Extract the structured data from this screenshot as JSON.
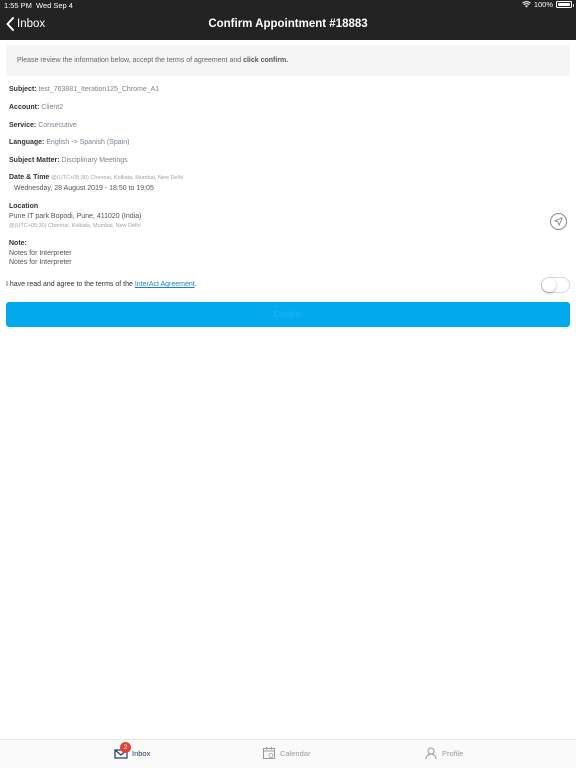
{
  "status_bar": {
    "time": "1:55 PM",
    "date": "Wed Sep 4",
    "battery": "100%"
  },
  "nav": {
    "back_label": "Inbox",
    "title": "Confirm Appointment #18883"
  },
  "info": {
    "text": "Please review the information below, accept the terms of agreement and ",
    "emphasis": "click confirm."
  },
  "fields": {
    "subject": {
      "label": "Subject:",
      "value": "test_763881_Iteration125_Chrome_A1"
    },
    "account": {
      "label": "Account:",
      "value": "Client2"
    },
    "service": {
      "label": "Service:",
      "value": "Consecutive"
    },
    "language": {
      "label": "Language:",
      "value": "English -> Spanish (Spain)"
    },
    "subject_matter": {
      "label": "Subject Matter:",
      "value": "Disciplinary Meetings"
    },
    "datetime": {
      "label": "Date & Time",
      "timezone": "@(UTC+05:30) Chennai, Kolkata, Mumbai, New Delhi",
      "value": "Wednesday, 28 August 2019 - 18:50 to 19:05"
    },
    "location": {
      "label": "Location",
      "address": "Pune IT park Bopodi, Pune, 411020 (India)",
      "timezone": "@(UTC+05:30) Chennai, Kolkata, Mumbai, New Delhi"
    },
    "note": {
      "label": "Note:",
      "lines": [
        "Notes for Interpreter",
        "Notes for Interpreter"
      ]
    }
  },
  "agreement": {
    "prefix": "I have read and agree to the terms of the ",
    "link": "InterAct Agreement",
    "suffix": ".",
    "checked": false
  },
  "confirm_button": {
    "label": "Confirm"
  },
  "tabs": [
    {
      "label": "Inbox",
      "badge": "2",
      "active": true
    },
    {
      "label": "Calendar",
      "active": false
    },
    {
      "label": "Profile",
      "active": false
    }
  ],
  "colors": {
    "bar": "#232323",
    "accent": "#03a9ed",
    "link": "#1a82d2",
    "badge": "#e34234"
  }
}
